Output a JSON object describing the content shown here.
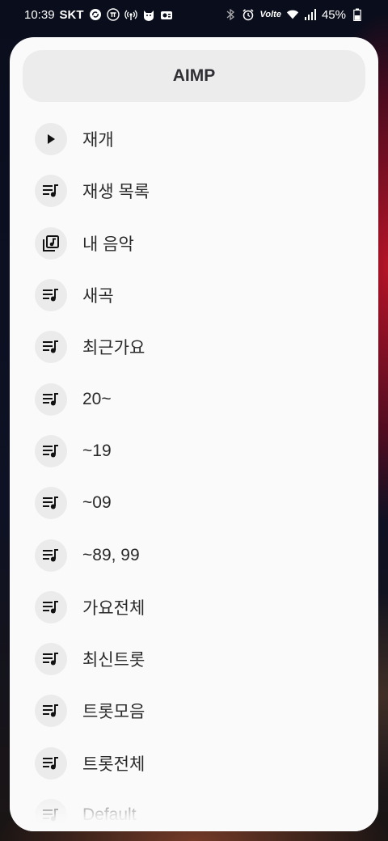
{
  "status_bar": {
    "time": "10:39",
    "carrier": "SKT",
    "battery": "45%",
    "left_icons": [
      "sync-icon",
      "pi-icon",
      "hotspot-icon",
      "cat-icon",
      "radio-icon"
    ],
    "right_icons": [
      "bluetooth-icon",
      "alarm-icon",
      "volte-icon",
      "wifi-icon",
      "signal-icon",
      "battery-icon"
    ],
    "volte_label": "Volte"
  },
  "dialog": {
    "title": "AIMP",
    "items": [
      {
        "label": "재개",
        "icon": "play-icon"
      },
      {
        "label": "재생 목록",
        "icon": "playlist-icon"
      },
      {
        "label": "내 음악",
        "icon": "music-library-icon"
      },
      {
        "label": "새곡",
        "icon": "playlist-icon"
      },
      {
        "label": "최근가요",
        "icon": "playlist-icon"
      },
      {
        "label": "20~",
        "icon": "playlist-icon"
      },
      {
        "label": "~19",
        "icon": "playlist-icon"
      },
      {
        "label": "~09",
        "icon": "playlist-icon"
      },
      {
        "label": "~89, 99",
        "icon": "playlist-icon"
      },
      {
        "label": "가요전체",
        "icon": "playlist-icon"
      },
      {
        "label": "최신트롯",
        "icon": "playlist-icon"
      },
      {
        "label": "트롯모음",
        "icon": "playlist-icon"
      },
      {
        "label": "트롯전체",
        "icon": "playlist-icon"
      },
      {
        "label": "Default",
        "icon": "playlist-icon"
      }
    ]
  },
  "colors": {
    "sheet_bg": "#fafafa",
    "header_bg": "#ececec",
    "icon_bg": "#ebebeb",
    "text": "#2a2a2a"
  }
}
